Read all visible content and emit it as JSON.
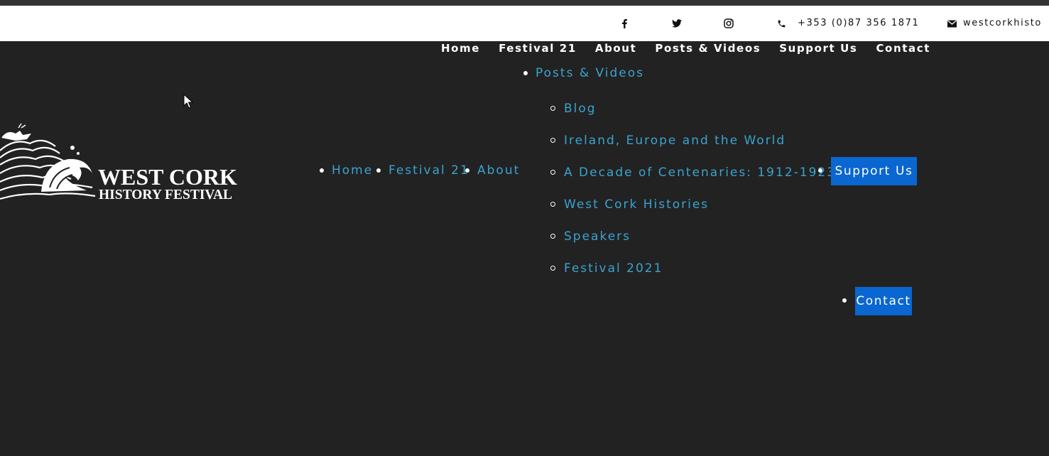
{
  "topbar": {
    "icons": [
      "facebook-icon",
      "twitter-icon",
      "instagram-icon",
      "phone-icon",
      "mail-icon"
    ],
    "phone": "+353 (0)87 356 1871",
    "email": "westcorkhisto"
  },
  "main_nav": {
    "home": "Home",
    "festival": "Festival 21",
    "about": "About",
    "posts": "Posts & Videos",
    "support": "Support Us",
    "contact": "Contact"
  },
  "logo": {
    "line1": "WEST CORK",
    "line2": "HISTORY FESTIVAL"
  },
  "expanded_menu": {
    "home": "Home",
    "festival": "Festival 21",
    "about": "About",
    "posts": "Posts & Videos",
    "submenu": [
      "Blog",
      "Ireland, Europe and the World",
      "A Decade of Centenaries: 1912-1923",
      "West Cork Histories",
      "Speakers",
      "Festival 2021"
    ],
    "support": "Support Us",
    "contact": "Contact"
  },
  "colors": {
    "background": "#222222",
    "link": "#3ba3cf",
    "highlight": "#0a66d0"
  }
}
